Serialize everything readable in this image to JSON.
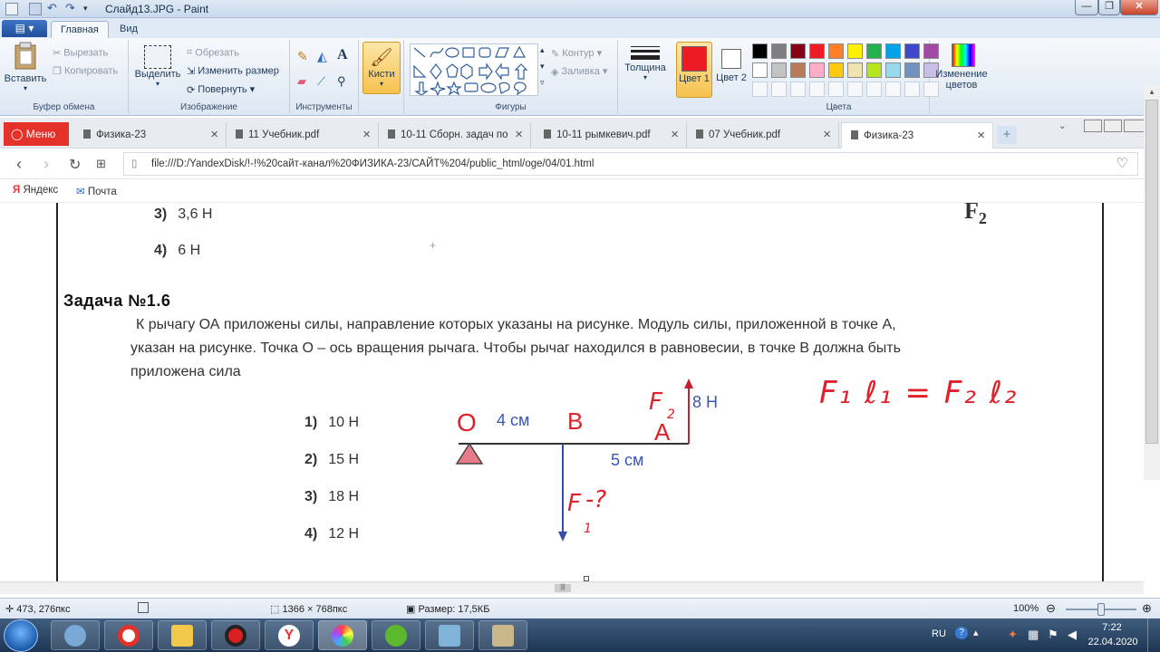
{
  "window": {
    "title": "Слайд13.JPG - Paint",
    "controls": [
      "—",
      "❐",
      "✕"
    ]
  },
  "ribbon_tabs": {
    "file_icon": "paint-menu-icon",
    "home": "Главная",
    "view": "Вид"
  },
  "ribbon": {
    "clipboard": {
      "label": "Буфер обмена",
      "paste": "Вставить",
      "cut": "Вырезать",
      "copy": "Копировать"
    },
    "image": {
      "label": "Изображение",
      "select": "Выделить",
      "crop": "Обрезать",
      "resize": "Изменить размер",
      "rotate": "Повернуть"
    },
    "tools": {
      "label": "Инструменты"
    },
    "brushes": {
      "label": "Кисти"
    },
    "shapes": {
      "label": "Фигуры",
      "outline": "Контур",
      "fill": "Заливка"
    },
    "size": {
      "label": "Толщина"
    },
    "color1": {
      "label": "Цвет 1",
      "value": "#ed1c24"
    },
    "color2": {
      "label": "Цвет 2",
      "value": "#ffffff"
    },
    "colors": {
      "label": "Цвета",
      "edit": "Изменение цветов",
      "row1": [
        "#000000",
        "#7f7f7f",
        "#880015",
        "#ed1c24",
        "#ff7f27",
        "#fff200",
        "#22b14c",
        "#00a2e8",
        "#3f48cc",
        "#a349a4"
      ],
      "row2": [
        "#ffffff",
        "#c3c3c3",
        "#b97a57",
        "#ffaec9",
        "#ffc90e",
        "#efe4b0",
        "#b5e61d",
        "#99d9ea",
        "#7092be",
        "#c8bfe7"
      ]
    }
  },
  "browser": {
    "menu": "Меню",
    "tabs": [
      {
        "title": "Физика-23"
      },
      {
        "title": "11 Учебник.pdf"
      },
      {
        "title": "10-11 Сборн. задач по"
      },
      {
        "title": "10-11 рымкевич.pdf"
      },
      {
        "title": "07 Учебник.pdf"
      },
      {
        "title": "Физика-23"
      }
    ],
    "url": "file:///D:/YandexDisk/!-!%20сайт-канал%20ФИЗИКА-23/САЙТ%204/public_html/oge/04/01.html",
    "bookmarks": [
      "Яндекс",
      "Почта"
    ]
  },
  "page": {
    "prev_answers": [
      {
        "num": "3)",
        "text": "3,6 Н"
      },
      {
        "num": "4)",
        "text": "6 Н"
      }
    ],
    "prev_label": "F",
    "prev_label_sub": "2",
    "task_title": "Задача №1.6",
    "task_lines": [
      "К рычагу ОА приложены силы, направление которых указаны на рисунке. Модуль силы, приложенной в точке А,",
      "указан на рисунке. Точка О – ось вращения рычага. Чтобы рычаг находился в равновесии, в точке В должна быть",
      "приложена сила"
    ],
    "answers": [
      {
        "num": "1)",
        "text": "10 Н"
      },
      {
        "num": "2)",
        "text": "15 Н"
      },
      {
        "num": "3)",
        "text": "18 Н"
      },
      {
        "num": "4)",
        "text": "12 Н"
      }
    ],
    "diagram": {
      "point_o": "O",
      "point_b": "B",
      "point_a": "A",
      "dist_ob": "4 см",
      "dist_ba": "5 см",
      "force_a": "8 Н",
      "hand_f2": "F",
      "hand_f2_sub": "2",
      "hand_f1": "F",
      "hand_f1_sub": "1",
      "hand_q": "-?",
      "hand_eq": "F₁ ℓ₁ = F₂ ℓ₂"
    }
  },
  "status": {
    "cursor_pos": "473, 276пкс",
    "image_size": "1366 × 768пкс",
    "file_size": "Размер: 17,5КБ",
    "zoom": "100%"
  },
  "taskbar": {
    "apps": [
      "start-orb-icon",
      "speaker-app-icon",
      "opera-icon",
      "explorer-icon",
      "recorder-icon",
      "yandex-browser-icon",
      "paint-icon",
      "utorrent-icon",
      "notepad-icon",
      "tools-icon"
    ],
    "lang": "RU",
    "time": "7:22",
    "date": "22.04.2020"
  }
}
